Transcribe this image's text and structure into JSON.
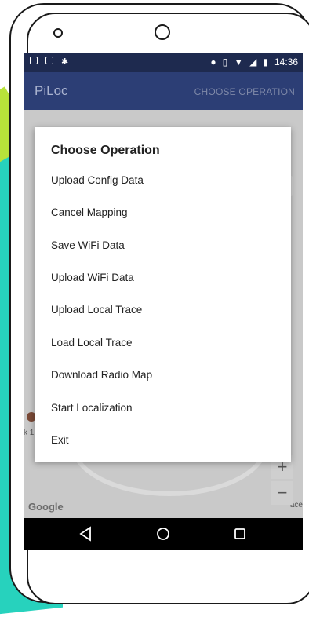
{
  "app": {
    "title": "PiLoc",
    "action_label": "CHOOSE OPERATION"
  },
  "status_bar": {
    "time": "14:36"
  },
  "dialog": {
    "title": "Choose Operation",
    "items": [
      "Upload Config Data",
      "Cancel Mapping",
      "Save WiFi Data",
      "Upload WiFi Data",
      "Upload Local Trace",
      "Load Local Trace",
      "Download Radio Map",
      "Start Localization",
      "Exit"
    ]
  },
  "map": {
    "provider_logo": "Google",
    "zoom_in": "+",
    "zoom_out": "−",
    "label_left": "k 1",
    "label_right": "ace"
  },
  "icons": {
    "nav": [
      "back-icon",
      "home-icon",
      "recents-icon"
    ]
  },
  "colors": {
    "status_bar": "#1e2a4f",
    "app_bar": "#2c3e75",
    "nav_bar": "#000000"
  }
}
